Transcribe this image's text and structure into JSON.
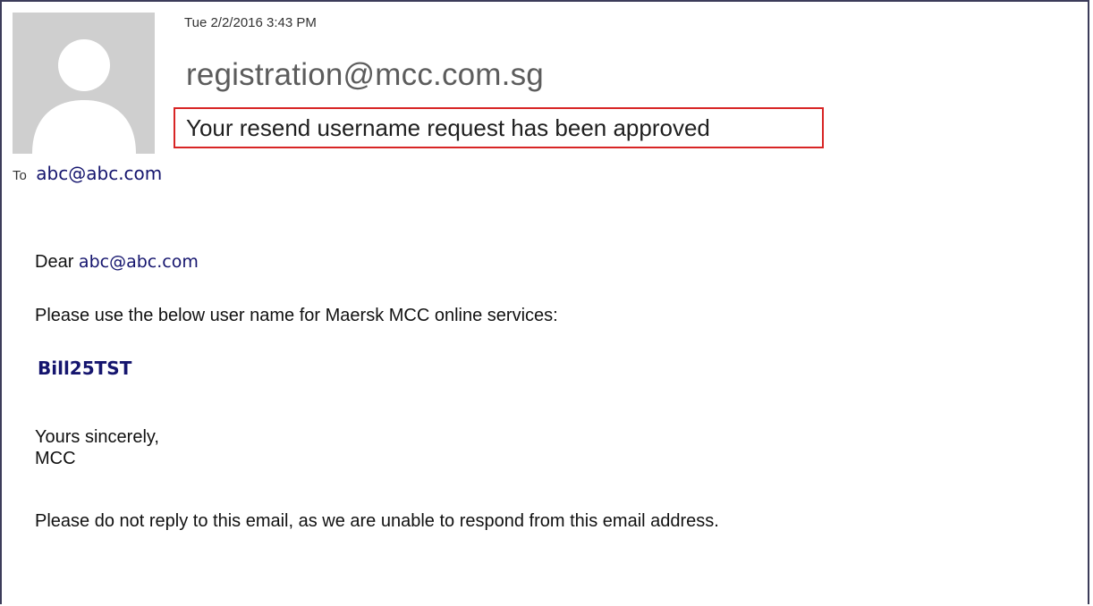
{
  "email": {
    "datetime": "Tue 2/2/2016 3:43 PM",
    "sender": "registration@mcc.com.sg",
    "subject": "Your resend username request has been approved",
    "to_label": "To",
    "to_address": "abc@abc.com"
  },
  "body": {
    "greeting": "Dear",
    "greeting_email": "abc@abc.com",
    "instruction": "Please use the below user name for Maersk MCC online services:",
    "username": "Bill25TST",
    "closing_line1": "Yours sincerely,",
    "closing_line2": "MCC",
    "footer_note": "Please do not reply to this email, as we are unable to respond from this email address."
  },
  "colors": {
    "subject_highlight": "#d82525",
    "link_text": "#15156e",
    "avatar_bg": "#cfcfcf"
  },
  "icons": {
    "avatar": "person-silhouette-icon"
  }
}
